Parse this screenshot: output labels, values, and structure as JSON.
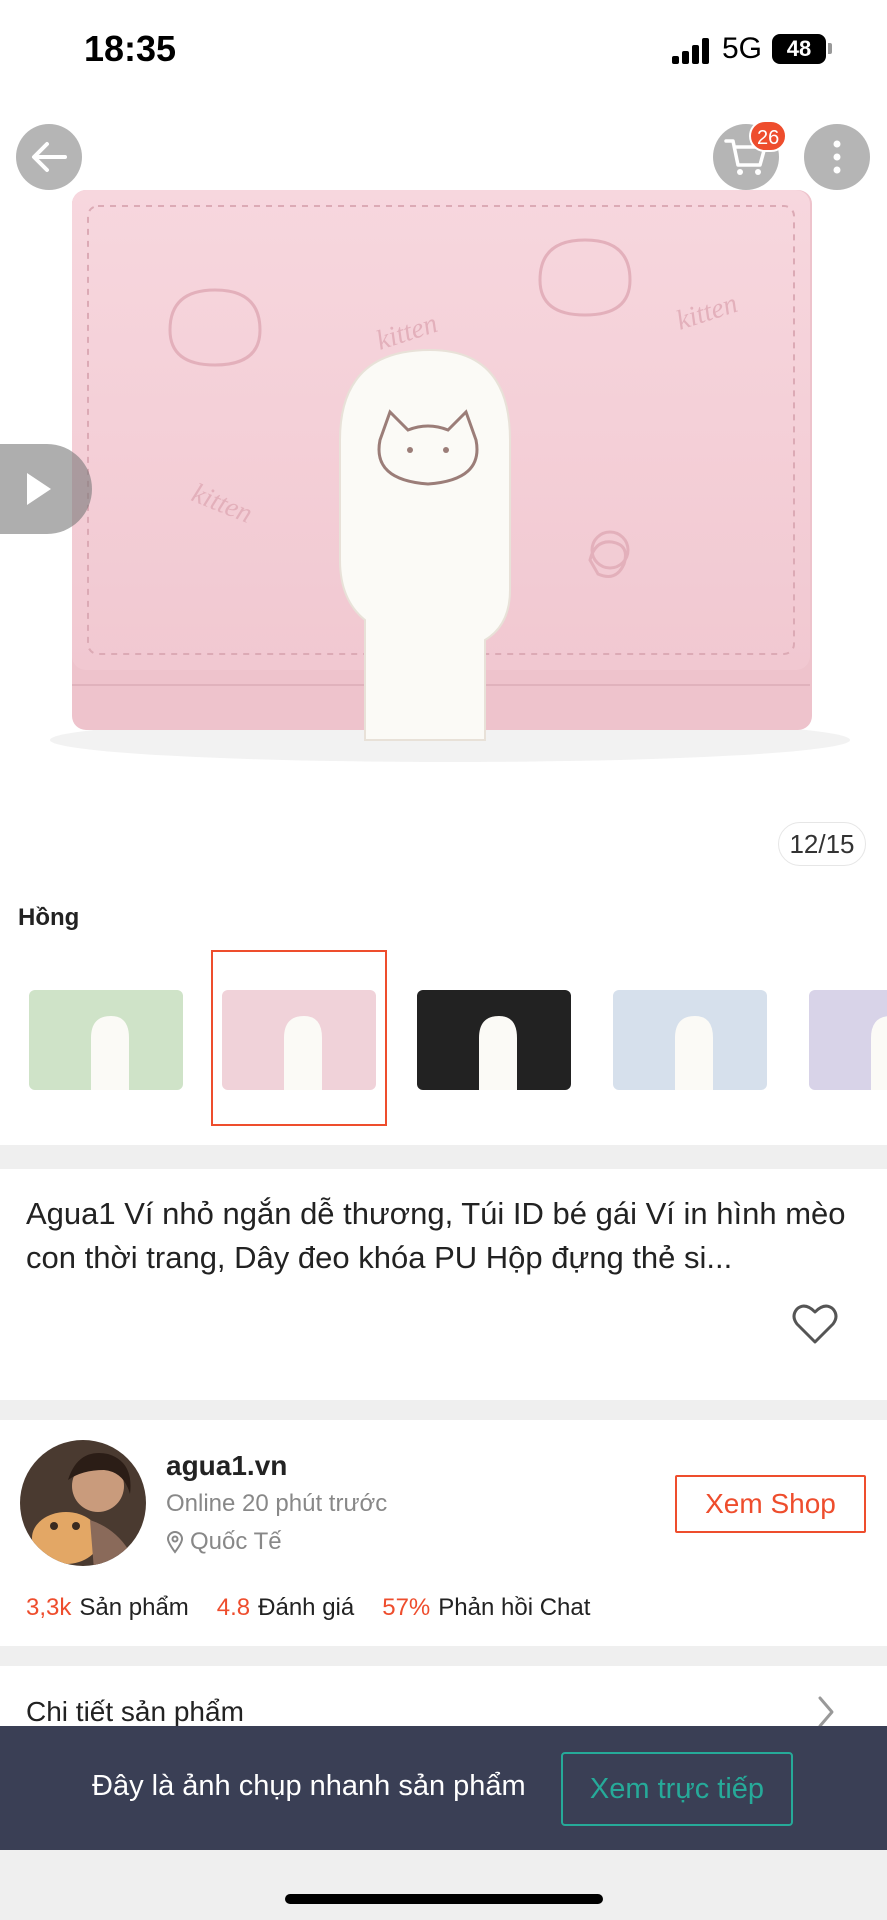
{
  "status_bar": {
    "time": "18:35",
    "network": "5G",
    "battery": "48"
  },
  "header": {
    "cart_badge": "26"
  },
  "gallery": {
    "counter": "12/15"
  },
  "variant": {
    "label": "Hồng",
    "options": [
      {
        "color": "#cfe3c8"
      },
      {
        "color": "#f0d2d9"
      },
      {
        "color": "#222222"
      },
      {
        "color": "#d6e0ec"
      },
      {
        "color": "#d8d3e8"
      }
    ],
    "selected_index": 1
  },
  "product": {
    "title": "Agua1 Ví nhỏ ngắn dễ thương, Túi ID bé gái Ví in hình mèo con thời trang, Dây đeo khóa PU Hộp đựng thẻ si..."
  },
  "shop": {
    "name": "agua1.vn",
    "online_status": "Online 20 phút trước",
    "location": "Quốc Tế",
    "view_button": "Xem Shop",
    "stats": [
      {
        "value": "3,3k",
        "label": "Sản phẩm"
      },
      {
        "value": "4.8",
        "label": "Đánh giá"
      },
      {
        "value": "57%",
        "label": "Phản hồi Chat"
      }
    ]
  },
  "details": {
    "label": "Chi tiết sản phẩm"
  },
  "snapshot_banner": {
    "text": "Đây là ảnh chụp nhanh sản phẩm",
    "button": "Xem trực tiếp"
  },
  "colors": {
    "accent": "#ee4d2d",
    "teal": "#26aa99",
    "banner": "#3a3f55"
  }
}
